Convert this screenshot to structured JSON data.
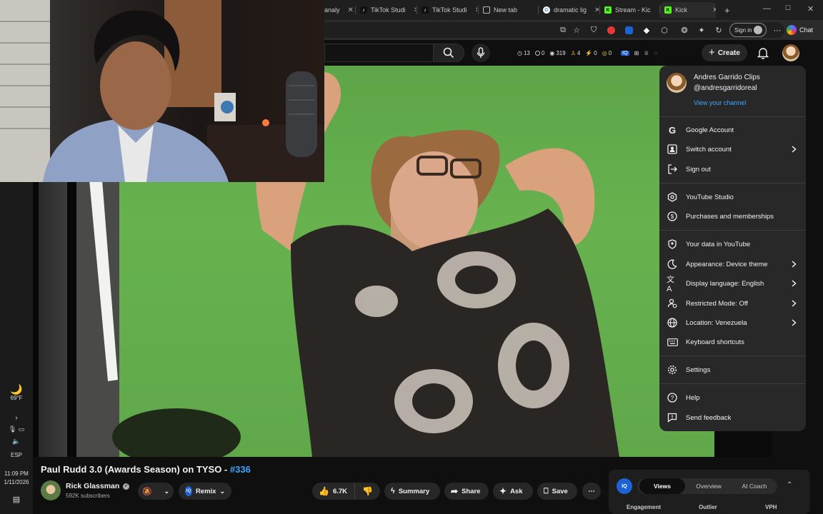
{
  "browser": {
    "tabs": [
      {
        "label": "analy"
      },
      {
        "label": "TikTok Studi"
      },
      {
        "label": "TikTok Studi"
      },
      {
        "label": "New tab"
      },
      {
        "label": "dramatic lig"
      },
      {
        "label": "Stream - Kic"
      },
      {
        "label": "Kick"
      }
    ],
    "new_tab_symbol": "+",
    "signin_label": "Sign in",
    "chat_label": "Chat"
  },
  "youtube": {
    "ext_stats": [
      "13",
      "0",
      "319",
      "4",
      "0",
      "0"
    ],
    "create_label": "Create",
    "video": {
      "title": "Paul Rudd 3.0 (Awards Season) on TYSO - ",
      "hashtag": "#336",
      "channel": "Rick Glassman",
      "subscribers": "592K subscribers",
      "remix_label": "Remix",
      "likes": "6.7K",
      "summary_label": "Summary",
      "share_label": "Share",
      "ask_label": "Ask",
      "save_label": "Save"
    },
    "stats_panel": {
      "badge": "IQ",
      "tabs": [
        "Views",
        "Overview",
        "AI Coach"
      ],
      "active_tab": "Views",
      "columns": [
        "Engagement",
        "Outlier",
        "VPH"
      ]
    },
    "account_menu": {
      "name": "Andres Garrido Clips",
      "handle": "@andresgarridoreal",
      "view_channel": "View your channel",
      "items": [
        {
          "label": "Google Account",
          "icon": "google-icon"
        },
        {
          "label": "Switch account",
          "icon": "switch-account-icon"
        },
        {
          "label": "Sign out",
          "icon": "sign-out-icon"
        },
        {
          "label": "YouTube Studio",
          "icon": "studio-icon"
        },
        {
          "label": "Purchases and memberships",
          "icon": "dollar-icon"
        },
        {
          "label": "Your data in YouTube",
          "icon": "shield-person-icon"
        },
        {
          "label": "Appearance: Device theme",
          "icon": "moon-icon"
        },
        {
          "label": "Display language: English",
          "icon": "translate-icon"
        },
        {
          "label": "Restricted Mode: Off",
          "icon": "restricted-icon"
        },
        {
          "label": "Location: Venezuela",
          "icon": "globe-icon"
        },
        {
          "label": "Keyboard shortcuts",
          "icon": "keyboard-icon"
        },
        {
          "label": "Settings",
          "icon": "settings-icon"
        },
        {
          "label": "Help",
          "icon": "help-icon"
        },
        {
          "label": "Send feedback",
          "icon": "feedback-icon"
        }
      ]
    }
  },
  "taskbar": {
    "temperature": "69°F",
    "lang": "ESP",
    "time": "11:09 PM",
    "date": "1/11/2026"
  },
  "colors": {
    "link": "#3ea6ff",
    "menu_bg": "#282828",
    "chroma_green": "#62aa4c"
  }
}
